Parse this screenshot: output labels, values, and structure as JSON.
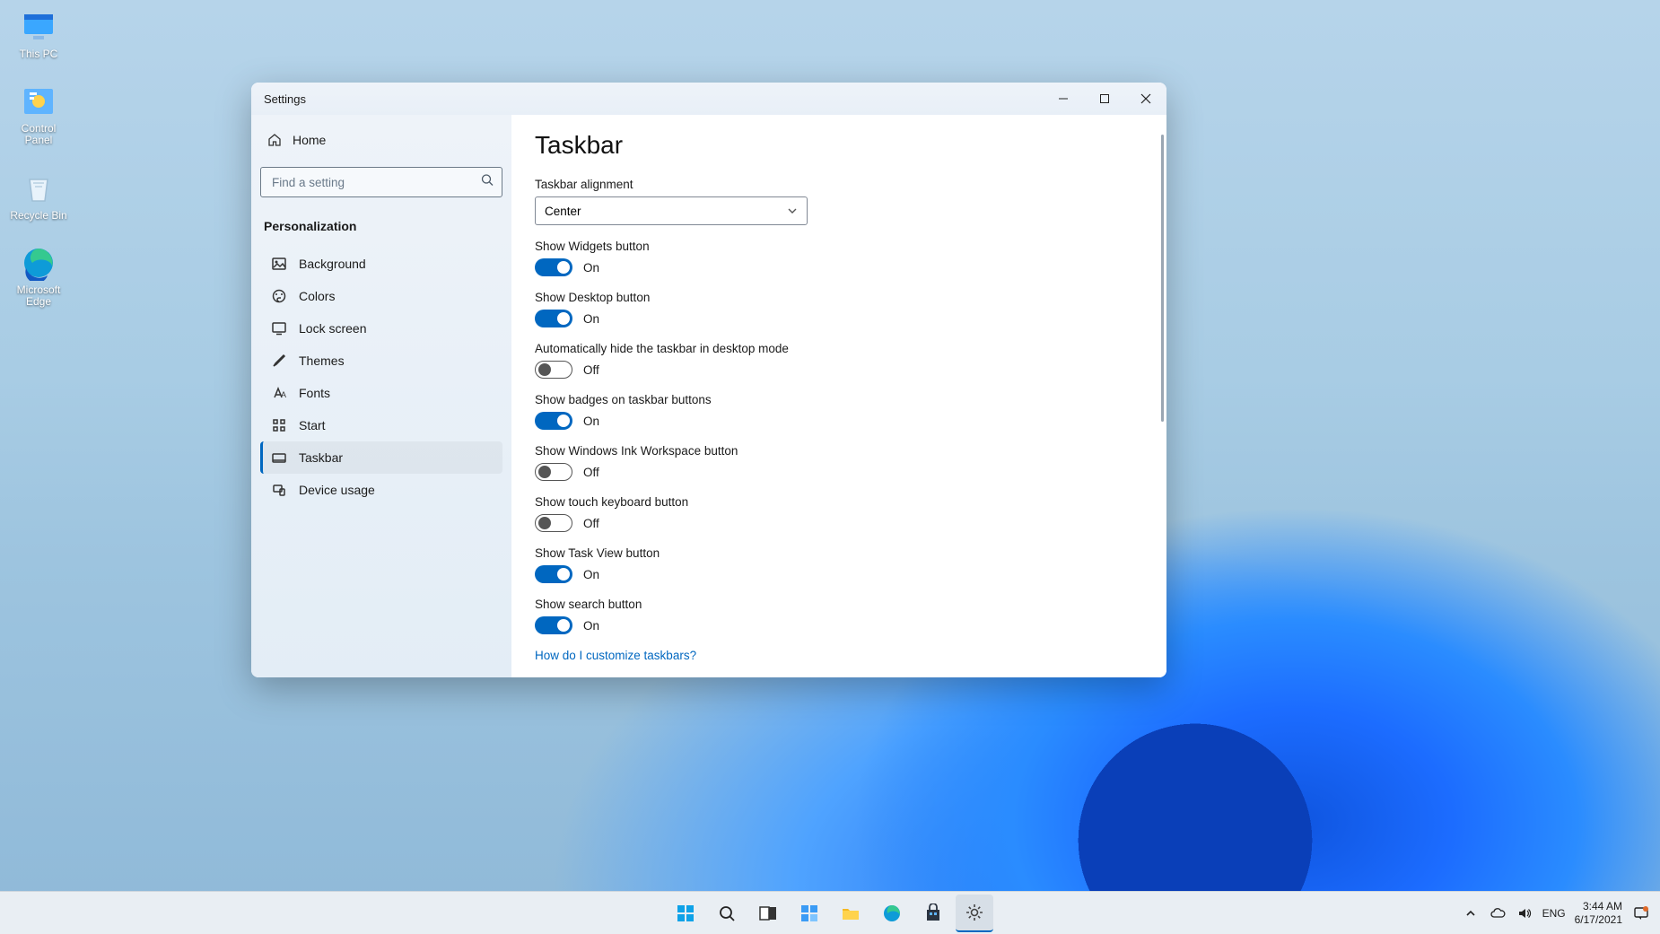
{
  "desktop_icons": [
    {
      "name": "this-pc",
      "label": "This PC"
    },
    {
      "name": "control-panel",
      "label": "Control Panel"
    },
    {
      "name": "recycle-bin",
      "label": "Recycle Bin"
    },
    {
      "name": "microsoft-edge",
      "label": "Microsoft Edge"
    }
  ],
  "window": {
    "title": "Settings",
    "home_label": "Home",
    "search_placeholder": "Find a setting",
    "section_label": "Personalization",
    "nav": [
      {
        "id": "background",
        "label": "Background",
        "icon": "image-icon",
        "active": false
      },
      {
        "id": "colors",
        "label": "Colors",
        "icon": "palette-icon",
        "active": false
      },
      {
        "id": "lockscreen",
        "label": "Lock screen",
        "icon": "monitor-icon",
        "active": false
      },
      {
        "id": "themes",
        "label": "Themes",
        "icon": "brush-icon",
        "active": false
      },
      {
        "id": "fonts",
        "label": "Fonts",
        "icon": "font-icon",
        "active": false
      },
      {
        "id": "start",
        "label": "Start",
        "icon": "grid-icon",
        "active": false
      },
      {
        "id": "taskbar",
        "label": "Taskbar",
        "icon": "taskbar-icon",
        "active": true
      },
      {
        "id": "deviceusage",
        "label": "Device usage",
        "icon": "device-icon",
        "active": false
      }
    ]
  },
  "content": {
    "heading": "Taskbar",
    "alignment_label": "Taskbar alignment",
    "alignment_value": "Center",
    "toggles": [
      {
        "label": "Show Widgets button",
        "state_text": "On",
        "on": true
      },
      {
        "label": "Show Desktop button",
        "state_text": "On",
        "on": true
      },
      {
        "label": "Automatically hide the taskbar in desktop mode",
        "state_text": "Off",
        "on": false
      },
      {
        "label": "Show badges on taskbar buttons",
        "state_text": "On",
        "on": true
      },
      {
        "label": "Show Windows Ink Workspace button",
        "state_text": "Off",
        "on": false
      },
      {
        "label": "Show touch keyboard button",
        "state_text": "Off",
        "on": false
      },
      {
        "label": "Show Task View button",
        "state_text": "On",
        "on": true
      },
      {
        "label": "Show search button",
        "state_text": "On",
        "on": true
      }
    ],
    "help_link": "How do I customize taskbars?"
  },
  "taskbar": {
    "lang": "ENG",
    "time": "3:44 AM",
    "date": "6/17/2021"
  }
}
